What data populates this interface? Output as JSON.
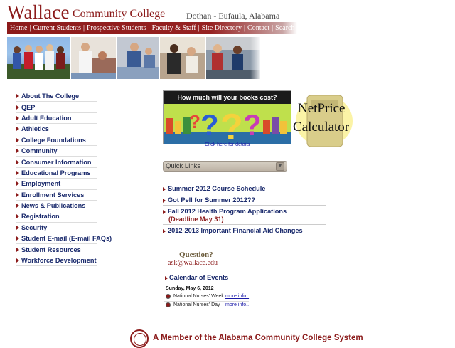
{
  "header": {
    "logo_wallace": "Wallace",
    "logo_cc": "Community College",
    "location": "Dothan - Eufaula, Alabama"
  },
  "nav": [
    {
      "label": "Home",
      "name": "nav-home"
    },
    {
      "label": "Current Students",
      "name": "nav-current-students"
    },
    {
      "label": "Prospective Students",
      "name": "nav-prospective-students"
    },
    {
      "label": "Faculty & Staff",
      "name": "nav-faculty-staff"
    },
    {
      "label": "Site Directory",
      "name": "nav-site-directory"
    },
    {
      "label": "Contact",
      "name": "nav-contact"
    },
    {
      "label": "Search",
      "name": "nav-search"
    }
  ],
  "sidebar": {
    "items": [
      {
        "label": "About The College"
      },
      {
        "label": "QEP"
      },
      {
        "label": "Adult Education"
      },
      {
        "label": "Athletics"
      },
      {
        "label": "College Foundations"
      },
      {
        "label": "Community"
      },
      {
        "label": "Consumer Information"
      },
      {
        "label": "Educational Programs"
      },
      {
        "label": "Employment"
      },
      {
        "label": "Enrollment Services"
      },
      {
        "label": "News & Publications"
      },
      {
        "label": "Registration"
      },
      {
        "label": "Security"
      },
      {
        "label": "Student E-mail (E-mail FAQs)"
      },
      {
        "label": "Student Resources"
      },
      {
        "label": "Workforce Development"
      }
    ]
  },
  "books_banner": {
    "title": "How much will your books cost?",
    "details_link": "Click here for details"
  },
  "net_price": {
    "line1": "NetPrice",
    "line2": "Calculator"
  },
  "quick_links": {
    "label": "Quick Links",
    "caret": "▼"
  },
  "news": [
    {
      "title": "Summer 2012 Course Schedule",
      "sub": ""
    },
    {
      "title": "Got Pell for Summer 2012??",
      "sub": ""
    },
    {
      "title": "Fall 2012 Health Program Applications",
      "sub": "(Deadline May 31)"
    },
    {
      "title": "2012-2013 Important Financial Aid Changes",
      "sub": ""
    }
  ],
  "question": {
    "line1": "Question?",
    "line2": "ask@wallace.edu"
  },
  "calendar": {
    "title": "Calendar of Events",
    "date": "Sunday, May 6, 2012",
    "events": [
      {
        "name": "National Nurses' Week",
        "more": "more info.."
      },
      {
        "name": "National Nurses' Day",
        "more": "more info.."
      }
    ]
  },
  "footer": {
    "text": "A Member of the Alabama Community College System"
  },
  "colors": {
    "brand": "#8b1a1a",
    "link": "#1a2a6c"
  }
}
